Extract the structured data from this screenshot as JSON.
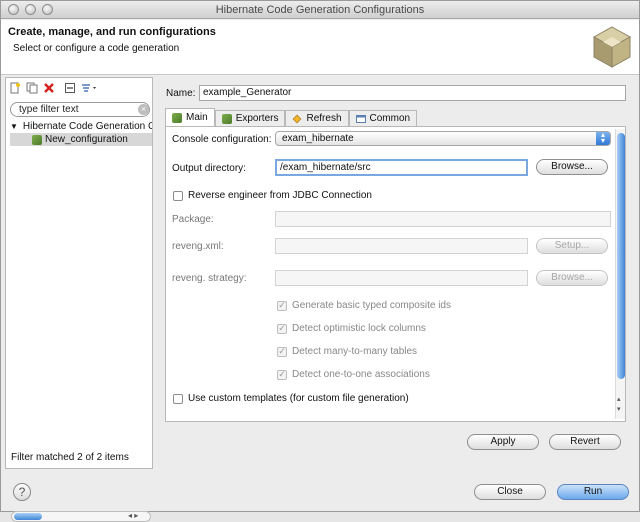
{
  "window": {
    "title": "Hibernate Code Generation Configurations"
  },
  "header": {
    "title": "Create, manage, and run configurations",
    "subtitle": "Select or configure a code generation",
    "logo_icon": "hibernate-logo-icon"
  },
  "left": {
    "toolbar_icons": [
      "new-config-icon",
      "duplicate-icon",
      "delete-icon",
      "collapse-all-icon",
      "filter-icon"
    ],
    "filter_placeholder": "type filter text",
    "tree": {
      "parent": "Hibernate Code Generation Configuration",
      "child": "New_configuration"
    },
    "status": "Filter matched 2 of 2 items"
  },
  "form": {
    "name_label": "Name:",
    "name_value": "example_Generator",
    "tabs": [
      {
        "label": "Main",
        "icon": "hibernate-icon"
      },
      {
        "label": "Exporters",
        "icon": "hibernate-icon"
      },
      {
        "label": "Refresh",
        "icon": "refresh-icon"
      },
      {
        "label": "Common",
        "icon": "common-icon"
      }
    ],
    "console_label": "Console configuration:",
    "console_value": "exam_hibernate",
    "output_label": "Output directory:",
    "output_value": "/exam_hibernate/src",
    "browse_label": "Browse...",
    "reverse_label": "Reverse engineer from JDBC Connection",
    "package_label": "Package:",
    "reveng_xml_label": "reveng.xml:",
    "setup_label": "Setup...",
    "reveng_strategy_label": "reveng. strategy:",
    "browse2_label": "Browse...",
    "checks": [
      "Generate basic typed composite ids",
      "Detect optimistic lock columns",
      "Detect many-to-many tables",
      "Detect one-to-one associations"
    ],
    "custom_templates_label": "Use custom templates (for custom file generation)",
    "apply_label": "Apply",
    "revert_label": "Revert"
  },
  "footer": {
    "close_label": "Close",
    "run_label": "Run",
    "help_icon": "help-icon"
  }
}
